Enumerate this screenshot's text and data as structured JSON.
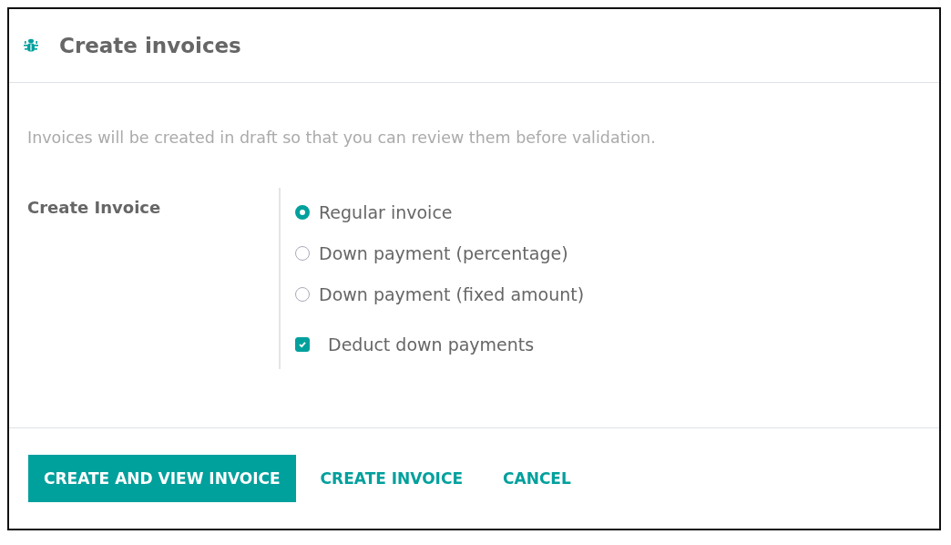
{
  "dialog": {
    "title": "Create invoices"
  },
  "intro": "Invoices will be created in draft so that you can review them before validation.",
  "field": {
    "label": "Create Invoice",
    "options": [
      {
        "kind": "radio",
        "label": "Regular invoice",
        "selected": true
      },
      {
        "kind": "radio",
        "label": "Down payment (percentage)",
        "selected": false
      },
      {
        "kind": "radio",
        "label": "Down payment (fixed amount)",
        "selected": false
      },
      {
        "kind": "checkbox",
        "label": "Deduct down payments",
        "checked": true
      }
    ]
  },
  "buttons": [
    {
      "kind": "primary",
      "label": "CREATE AND VIEW INVOICE"
    },
    {
      "kind": "link",
      "label": "CREATE INVOICE"
    },
    {
      "kind": "link",
      "label": "CANCEL"
    }
  ]
}
